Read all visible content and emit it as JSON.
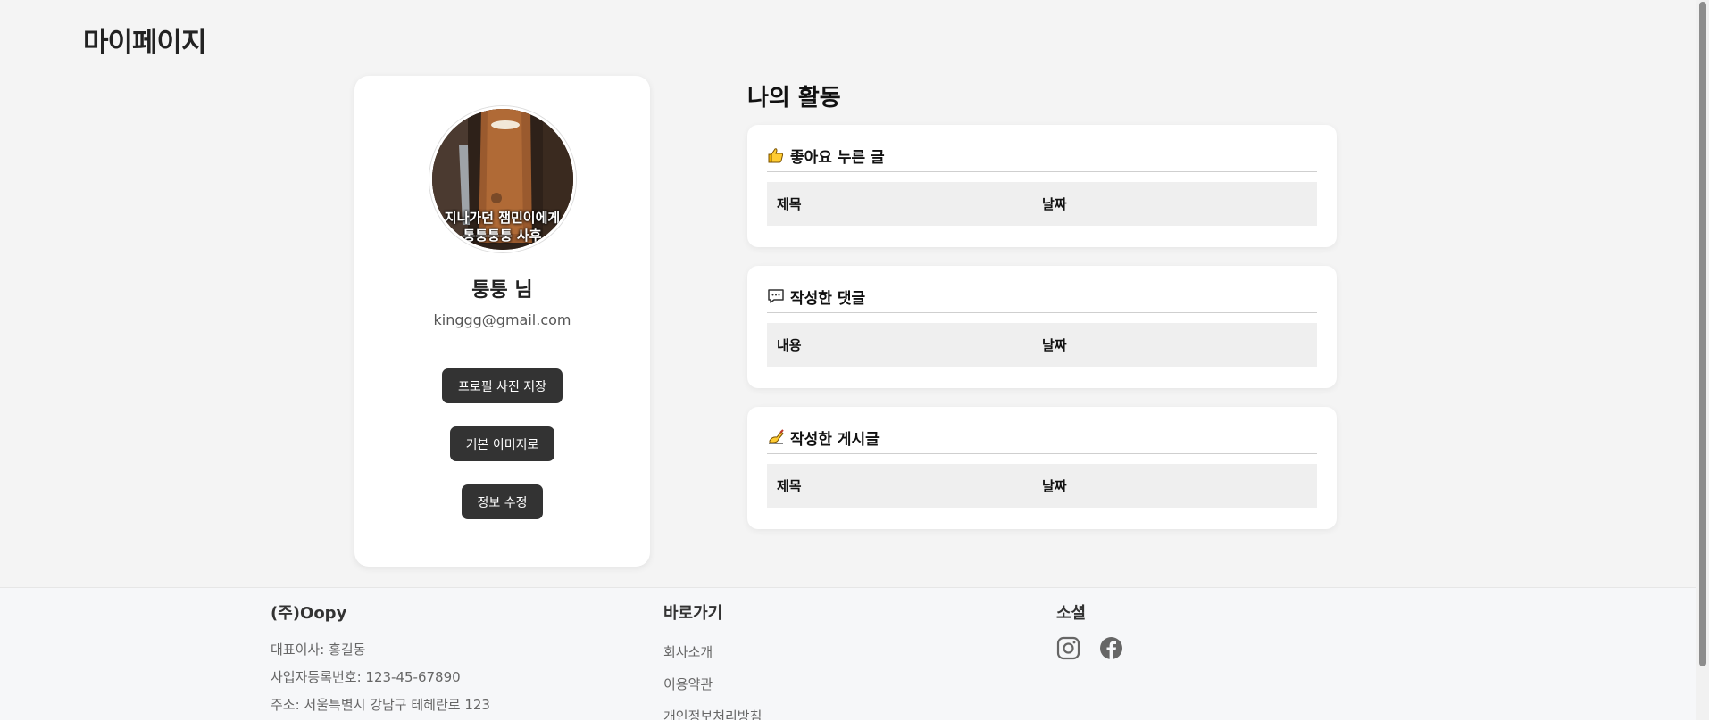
{
  "page": {
    "title": "마이페이지"
  },
  "profile": {
    "avatar_caption_line1": "지나가던 잼민이에게",
    "avatar_caption_line2": "통퉁퉁퉁 사후",
    "name": "퉁퉁 님",
    "email": "kinggg@gmail.com",
    "buttons": {
      "save_photo": "프로필 사진 저장",
      "default_image": "기본 이미지로",
      "edit_info": "정보 수정"
    }
  },
  "activity": {
    "title": "나의 활동",
    "sections": [
      {
        "icon": "thumbs-up-icon",
        "heading": "좋아요 누른 글",
        "col1": "제목",
        "col2": "날짜"
      },
      {
        "icon": "speech-bubble-icon",
        "heading": "작성한 댓글",
        "col1": "내용",
        "col2": "날짜"
      },
      {
        "icon": "writing-hand-icon",
        "heading": "작성한 게시글",
        "col1": "제목",
        "col2": "날짜"
      }
    ]
  },
  "footer": {
    "company": {
      "name": "(주)Oopy",
      "ceo": "대표이사: 홍길동",
      "business_no": "사업자등록번호: 123-45-67890",
      "address": "주소: 서울특별시 강남구 테헤란로 123"
    },
    "links": {
      "heading": "바로가기",
      "items": [
        "회사소개",
        "이용약관",
        "개인정보처리방침"
      ]
    },
    "social": {
      "heading": "소셜",
      "icons": [
        "instagram-icon",
        "facebook-icon"
      ]
    }
  },
  "colors": {
    "background": "#f4f4f4",
    "button": "#333333",
    "card": "#ffffff",
    "footer": "#f6f7f9"
  }
}
